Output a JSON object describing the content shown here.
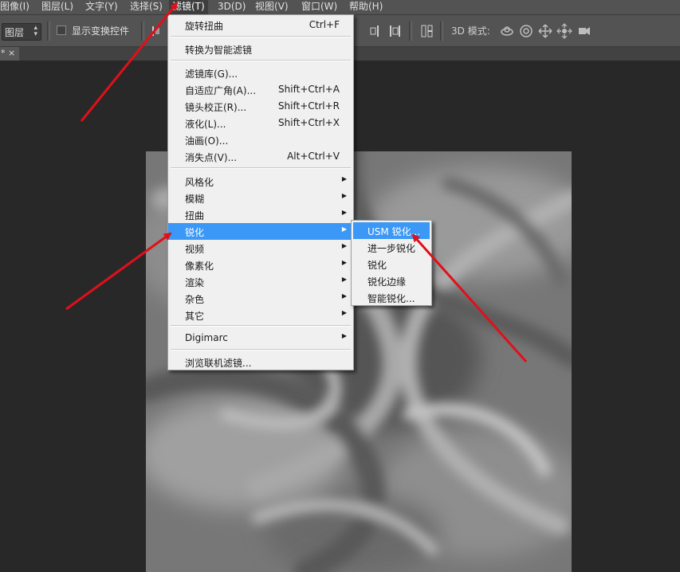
{
  "menubar": {
    "items": [
      {
        "label": "图像(I)"
      },
      {
        "label": "图层(L)"
      },
      {
        "label": "文字(Y)"
      },
      {
        "label": "选择(S)"
      },
      {
        "label": "滤镜(T)"
      },
      {
        "label": "3D(D)"
      },
      {
        "label": "视图(V)"
      },
      {
        "label": "窗口(W)"
      },
      {
        "label": "帮助(H)"
      }
    ]
  },
  "options": {
    "layer_select": "图层",
    "show_transform_label": "显示变换控件",
    "mode_3d_label": "3D 模式:"
  },
  "tab": {
    "label": "* ×"
  },
  "filter_menu": {
    "items": [
      {
        "label": "旋转扭曲",
        "shortcut": "Ctrl+F"
      },
      {
        "label": "转换为智能滤镜"
      },
      {
        "label": "滤镜库(G)..."
      },
      {
        "label": "自适应广角(A)...",
        "shortcut": "Shift+Ctrl+A"
      },
      {
        "label": "镜头校正(R)...",
        "shortcut": "Shift+Ctrl+R"
      },
      {
        "label": "液化(L)...",
        "shortcut": "Shift+Ctrl+X"
      },
      {
        "label": "油画(O)..."
      },
      {
        "label": "消失点(V)...",
        "shortcut": "Alt+Ctrl+V"
      },
      {
        "label": "风格化"
      },
      {
        "label": "模糊"
      },
      {
        "label": "扭曲"
      },
      {
        "label": "锐化"
      },
      {
        "label": "视频"
      },
      {
        "label": "像素化"
      },
      {
        "label": "渲染"
      },
      {
        "label": "杂色"
      },
      {
        "label": "其它"
      },
      {
        "label": "Digimarc"
      },
      {
        "label": "浏览联机滤镜..."
      }
    ],
    "submenu_arrow": "▶"
  },
  "sharpen_submenu": {
    "items": [
      {
        "label": "USM 锐化..."
      },
      {
        "label": "进一步锐化"
      },
      {
        "label": "锐化"
      },
      {
        "label": "锐化边缘"
      },
      {
        "label": "智能锐化..."
      }
    ]
  },
  "colors": {
    "menu_highlight": "#3b98f6",
    "annotation_arrow": "#e0101a",
    "app_background": "#282828",
    "toolbar": "#535353"
  }
}
